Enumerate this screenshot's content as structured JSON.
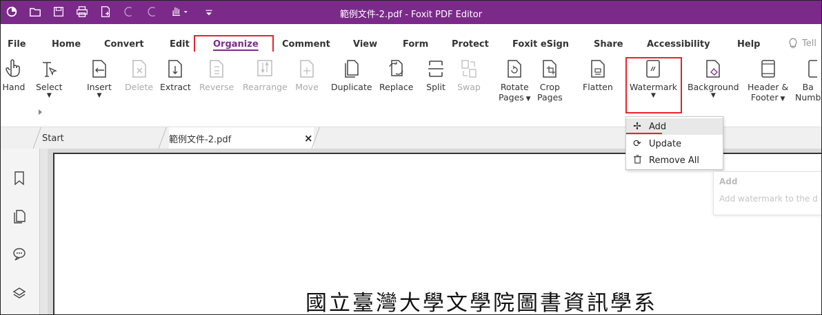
{
  "title_bar": {
    "title": "範例文件-2.pdf - Foxit PDF Editor",
    "quick_access_icons": [
      "foxit-logo-icon",
      "open-folder-icon",
      "save-icon",
      "print-icon",
      "new-icon",
      "undo-icon",
      "redo-icon",
      "hand-dropdown-icon",
      "customize-icon"
    ]
  },
  "menu": {
    "items": [
      "File",
      "Home",
      "Convert",
      "Edit",
      "Organize",
      "Comment",
      "View",
      "Form",
      "Protect",
      "Foxit eSign",
      "Share",
      "Accessibility",
      "Help"
    ],
    "active": "Organize",
    "tell_me": "Tell"
  },
  "ribbon": {
    "tools": [
      {
        "label": "Hand",
        "icon": "hand-icon",
        "enabled": true
      },
      {
        "label": "Select",
        "icon": "select-icon",
        "enabled": true,
        "dropdown": true
      },
      {
        "label": "Insert",
        "icon": "insert-page-icon",
        "enabled": true,
        "dropdown": true
      },
      {
        "label": "Delete",
        "icon": "delete-page-icon",
        "enabled": false
      },
      {
        "label": "Extract",
        "icon": "extract-page-icon",
        "enabled": true
      },
      {
        "label": "Reverse",
        "icon": "reverse-icon",
        "enabled": false
      },
      {
        "label": "Rearrange",
        "icon": "rearrange-icon",
        "enabled": false
      },
      {
        "label": "Move",
        "icon": "move-page-icon",
        "enabled": false
      },
      {
        "label": "Duplicate",
        "icon": "duplicate-icon",
        "enabled": true
      },
      {
        "label": "Replace",
        "icon": "replace-icon",
        "enabled": true
      },
      {
        "label": "Split",
        "icon": "split-icon",
        "enabled": true
      },
      {
        "label": "Swap",
        "icon": "swap-icon",
        "enabled": false
      },
      {
        "label": "Rotate",
        "label2": "Pages",
        "icon": "rotate-icon",
        "enabled": true,
        "dropdown": true
      },
      {
        "label": "Crop",
        "label2": "Pages",
        "icon": "crop-icon",
        "enabled": true
      },
      {
        "label": "Flatten",
        "icon": "flatten-icon",
        "enabled": true
      },
      {
        "label": "Watermark",
        "icon": "watermark-icon",
        "enabled": true,
        "dropdown": true
      },
      {
        "label": "Background",
        "icon": "background-icon",
        "enabled": true,
        "dropdown": true
      },
      {
        "label": "Header &",
        "label2": "Footer",
        "icon": "header-footer-icon",
        "enabled": true,
        "dropdown": true
      },
      {
        "label": "Ba",
        "label2": "Numb",
        "icon": "bates-icon",
        "enabled": true
      }
    ]
  },
  "tabs": {
    "start": "Start",
    "doc": "範例文件-2.pdf",
    "close": "×"
  },
  "watermark_menu": {
    "items": [
      {
        "label": "Add",
        "icon": "add-icon"
      },
      {
        "label": "Update",
        "icon": "update-icon"
      },
      {
        "label": "Remove All",
        "icon": "remove-all-icon"
      }
    ]
  },
  "tooltip": {
    "title": "Add",
    "description": "Add watermark to the d"
  },
  "document": {
    "heading": "國立臺灣大學文學院圖書資訊學系"
  },
  "colors": {
    "titlebar": "#7b2a8a",
    "accent": "#7b2a8a",
    "highlight": "#e5242a"
  }
}
